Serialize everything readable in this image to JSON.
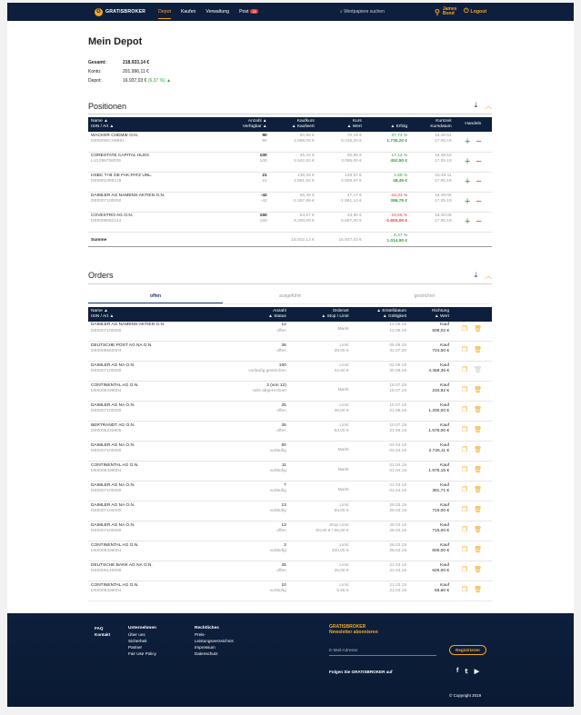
{
  "nav": {
    "brand": "GRATISBROKER",
    "links": [
      "Depot",
      "Kaufen",
      "Verwaltung",
      "Post"
    ],
    "post_badge": "26",
    "search_placeholder": "Wertpapiere suchen",
    "user": "James Bond",
    "logout": "Logout"
  },
  "page": {
    "title": "Mein Depot"
  },
  "summary": {
    "gesamt_label": "Gesamt:",
    "gesamt_value": "218.933,14 €",
    "konto_label": "Konto:",
    "konto_value": "201.996,11 €",
    "depot_label": "Depot:",
    "depot_value": "16.937,03 €",
    "depot_change": "(6,37 %) ▲"
  },
  "positionen": {
    "title": "Positionen",
    "headers": {
      "name": "Name",
      "isin": "ISIN / Art",
      "anzahl": "Anzahl",
      "verf": "Verfügbar",
      "kaufkurs": "Kaufkurs",
      "kaufwert": "Kaufwert",
      "kurs": "Kurs",
      "wert": "Wert",
      "erfolg": "Erfolg",
      "kurszeit": "Kurszeit",
      "kursdatum": "Kursdatum",
      "handeln": "Handeln"
    },
    "rows": [
      {
        "name": "WACKER CHEMIE O.N.",
        "isin": "DE000WCH8881",
        "anzahl": "90",
        "verf": "90",
        "kaufkurs": "50,96 €",
        "kaufwert": "4.586,00 €",
        "kurs": "70,18 €",
        "wert": "6.316,20 €",
        "erfolg_pct": "37,73 %",
        "erfolg_abs": "1.730,20 €",
        "pos": true,
        "zeit": "16:48:51",
        "datum": "17.05.19"
      },
      {
        "name": "CORESTATE CAPITAL HLDG",
        "isin": "LU1296758029",
        "anzahl": "100",
        "verf": "100",
        "kaufkurs": "26,43 €",
        "kaufwert": "2.642,50 €",
        "kurs": "30,95 €",
        "wert": "3.095,00 €",
        "erfolg_pct": "17,12 %",
        "erfolg_abs": "452,50 €",
        "pos": true,
        "zeit": "16:48:53",
        "datum": "17.05.19"
      },
      {
        "name": "HSBC T+B OE FAK.PATZ UNL.",
        "isin": "DE0001399129",
        "anzahl": "21",
        "verf": "21",
        "kaufkurs": "136,26 €",
        "kaufwert": "2.861,52 €",
        "kurs": "138,57 €",
        "wert": "2.909,97 €",
        "erfolg_pct": "1,69 %",
        "erfolg_abs": "48,45 €",
        "pos": true,
        "zeit": "16:49:11",
        "datum": "17.05.19"
      },
      {
        "name": "DAIMLER AG NAMENS-AKTIEN O.N.",
        "isin": "DE0007100000",
        "anzahl": "-42",
        "verf": "-42",
        "kaufkurs": "56,38 €",
        "kaufwert": "-2.367,89 €",
        "kurs": "47,17 €",
        "wert": "-1.981,14 €",
        "erfolg_pct": "-16,33 %",
        "erfolg_abs": "386,75 €",
        "pos": true,
        "zeit": "16:49:05",
        "datum": "17.05.19"
      },
      {
        "name": "COVESTRO AG O.N.",
        "isin": "DE0006062144",
        "anzahl": "150",
        "verf": "150",
        "kaufkurs": "54,67 €",
        "kaufwert": "8.200,00 €",
        "kurs": "43,98 €",
        "wert": "6.597,00 €",
        "erfolg_pct": "-19,55 %",
        "erfolg_abs": "-1.603,00 €",
        "pos": false,
        "zeit": "16:49:08",
        "datum": "17.05.19"
      }
    ],
    "sum": {
      "label": "Summe",
      "kaufwert": "15.922,13 €",
      "wert": "16.937,03 €",
      "erfolg_pct": "6,37 %",
      "erfolg_abs": "1.014,90 €"
    }
  },
  "orders": {
    "title": "Orders",
    "tabs": [
      "offen",
      "ausgeführt",
      "gestrichen"
    ],
    "headers": {
      "name": "Name",
      "isin": "ISIN / Art",
      "anzahl": "Anzahl",
      "status": "Status",
      "orderart": "Orderart",
      "stop": "Stop / Limit",
      "erstell": "Erstelldatum",
      "gueltig": "Gültigkeit",
      "richtung": "Richtung",
      "wert": "Wert"
    },
    "rows": [
      {
        "name": "DAIMLER AG NAMENS-AKTIEN O.N.",
        "isin": "DE0007100000",
        "anzahl": "12",
        "status": "offen",
        "art": "Markt",
        "limit": "",
        "d1": "12.09.19",
        "d2": "12.09.19",
        "richtung": "Kauf",
        "wert": "508,02 €",
        "del": true
      },
      {
        "name": "DEUTSCHE POST AG NA O.N.",
        "isin": "DE0005552004",
        "anzahl": "26",
        "status": "offen",
        "art": "Limit",
        "limit": "28,00 €",
        "d1": "05.08.19",
        "d2": "31.07.20",
        "richtung": "Kauf",
        "wert": "724,50 €",
        "del": true
      },
      {
        "name": "DAIMLER AG NA O.N.",
        "isin": "DE0007100000",
        "anzahl": "100",
        "status": "vorläufig gestrichen",
        "art": "Limit",
        "limit": "44,50 €",
        "d1": "02.08.19",
        "d2": "30.08.19",
        "richtung": "Kauf",
        "wert": "4.459,36 €",
        "del": false
      },
      {
        "name": "CONTINENTAL AG O.N.",
        "isin": "DE0005439004",
        "anzahl": "2 (von 12)",
        "status": "teils abgerechnet",
        "art": "Markt",
        "limit": "",
        "d1": "18.07.19",
        "d2": "18.07.19",
        "richtung": "Kauf",
        "wert": "234,92 €",
        "del": true
      },
      {
        "name": "DAIMLER AG NA O.N.",
        "isin": "DE0007100000",
        "anzahl": "25",
        "status": "offen",
        "art": "Limit",
        "limit": "48,00 €",
        "d1": "10.07.19",
        "d2": "21.08.19",
        "richtung": "Kauf",
        "wert": "1.200,00 €",
        "del": true
      },
      {
        "name": "BERTRANDT AG O.N.",
        "isin": "DE0005232805",
        "anzahl": "26",
        "status": "offen",
        "art": "Limit",
        "limit": "63,00 €",
        "d1": "10.07.19",
        "d2": "21.08.19",
        "richtung": "Kauf",
        "wert": "1.575,00 €",
        "del": true
      },
      {
        "name": "DAIMLER AG NA O.N.",
        "isin": "DE0007100000",
        "anzahl": "50",
        "status": "vorläufig",
        "art": "Markt",
        "limit": "",
        "d1": "04.04.19",
        "d2": "04.04.19",
        "richtung": "Kauf",
        "wert": "2.726,11 €",
        "del": true
      },
      {
        "name": "CONTINENTAL AG O.N.",
        "isin": "DE0005439004",
        "anzahl": "11",
        "status": "vorläufig",
        "art": "Markt",
        "limit": "",
        "d1": "01.04.19",
        "d2": "01.04.19",
        "richtung": "Kauf",
        "wert": "1.676,15 €",
        "del": true
      },
      {
        "name": "DAIMLER AG NA O.N.",
        "isin": "DE0007100000",
        "anzahl": "7",
        "status": "vorläufig",
        "art": "Markt",
        "limit": "",
        "d1": "01.04.19",
        "d2": "01.04.19",
        "richtung": "Kauf",
        "wert": "381,71 €",
        "del": true
      },
      {
        "name": "DAIMLER AG NA O.N.",
        "isin": "DE0007100000",
        "anzahl": "13",
        "status": "vorläufig",
        "art": "Limit",
        "limit": "55,00 €",
        "d1": "29.03.19",
        "d2": "29.03.19",
        "richtung": "Kauf",
        "wert": "715,00 €",
        "del": true
      },
      {
        "name": "DAIMLER AG NA O.N.",
        "isin": "DE0007100000",
        "anzahl": "13",
        "status": "offen",
        "art": "Stop Limit",
        "limit": "50,00 € / 55,00 €",
        "d1": "29.03.19",
        "d2": "29.03.19",
        "richtung": "Kauf",
        "wert": "715,00 €",
        "del": true
      },
      {
        "name": "CONTINENTAL AG O.N.",
        "isin": "DE0005439004",
        "anzahl": "3",
        "status": "vorläufig",
        "art": "Limit",
        "limit": "200,00 €",
        "d1": "26.03.19",
        "d2": "26.03.19",
        "richtung": "Kauf",
        "wert": "600,00 €",
        "del": true
      },
      {
        "name": "DEUTSCHE BANK AG NA O.N.",
        "isin": "DE0005140008",
        "anzahl": "25",
        "status": "offen",
        "art": "Limit",
        "limit": "25,00 €",
        "d1": "21.03.19",
        "d2": "22.03.19",
        "richtung": "Kauf",
        "wert": "625,00 €",
        "del": true
      },
      {
        "name": "CONTINENTAL AG O.N.",
        "isin": "DE0005439004",
        "anzahl": "10",
        "status": "vorläufig",
        "art": "Limit",
        "limit": "5,56 €",
        "d1": "21.03.19",
        "d2": "21.03.19",
        "richtung": "Kauf",
        "wert": "55,60 €",
        "del": true
      }
    ]
  },
  "footer": {
    "faq": "FAQ",
    "kontakt": "Kontakt",
    "unternehmen": "Unternehmen",
    "unternehmen_items": [
      "Über uns",
      "Sicherheit",
      "Partner",
      "Fair Use Policy"
    ],
    "rechtliches": "Rechtliches",
    "rechtliches_items": [
      "Preis-",
      "Leistungsverzeichnis",
      "Impressum",
      "Datenschutz"
    ],
    "nl_brand": "GRATISBROKER",
    "nl_title": "Newsletter abonnieren",
    "email_placeholder": "E-Mail-Adresse",
    "register": "Registrieren",
    "follow": "Folgen Sie GRATISBROKER auf",
    "copyright": "© Copyright 2019"
  },
  "colors": {
    "navy": "#0d1f3c",
    "accent": "#f5a623",
    "green": "#2e9e3e",
    "red": "#e53935"
  }
}
